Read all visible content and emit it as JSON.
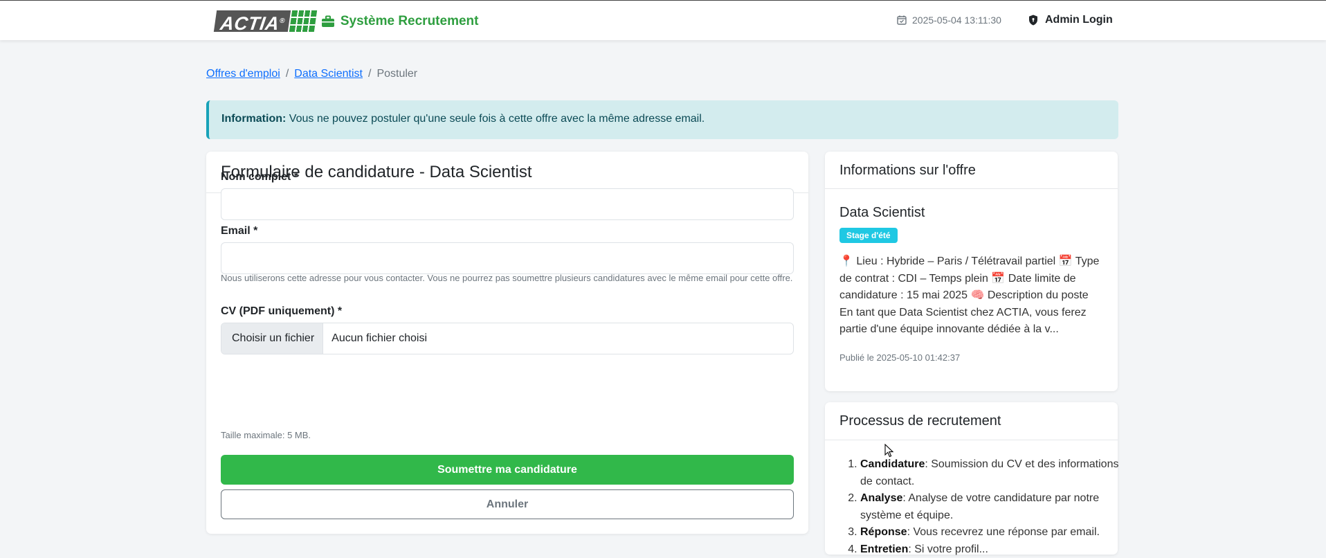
{
  "header": {
    "logo_text": "ACTIA",
    "logo_reg": "®",
    "title": "Système Recrutement",
    "datetime": "2025-05-04 13:11:30",
    "admin_label": "Admin Login",
    "brand_color": "#2e9e3f"
  },
  "breadcrumb": {
    "items": [
      "Offres d'emploi",
      "Data Scientist",
      "Postuler"
    ],
    "separator": "/"
  },
  "alert": {
    "title": "Information:",
    "message": "Vous ne pouvez postuler qu'une seule fois à cette offre avec la même adresse email."
  },
  "form": {
    "title": "Formulaire de candidature - Data Scientist",
    "name_label": "Nom complet *",
    "email_label": "Email *",
    "email_help": "Nous utiliserons cette adresse pour vous contacter. Vous ne pourrez pas soumettre plusieurs candidatures avec le même email pour cette offre.",
    "cv_label": "CV (PDF uniquement) *",
    "file_button": "Choisir un fichier",
    "file_status": "Aucun fichier choisi",
    "cv_help": "Taille maximale: 5 MB.",
    "submit_label": "Soumettre ma candidature",
    "cancel_label": "Annuler",
    "submit_color": "#31b84a"
  },
  "offer": {
    "card_title": "Informations sur l'offre",
    "job_title": "Data Scientist",
    "badge": "Stage d'été",
    "description": "📍 Lieu : Hybride – Paris / Télétravail partiel 📅 Type de contrat : CDI – Temps plein 📅 Date limite de candidature : 15 mai 2025 🧠 Description du poste En tant que Data Scientist chez ACTIA, vous ferez partie d'une équipe innovante dédiée à la v...",
    "published": "Publié le 2025-05-10 01:42:37"
  },
  "process": {
    "card_title": "Processus de recrutement",
    "steps": [
      {
        "name": "Candidature",
        "text": ": Soumission du CV et des informations de contact."
      },
      {
        "name": "Analyse",
        "text": ": Analyse de votre candidature par notre système et équipe."
      },
      {
        "name": "Réponse",
        "text": ": Vous recevrez une réponse par email."
      },
      {
        "name": "Entretien",
        "text": ": Si votre profil..."
      }
    ]
  }
}
